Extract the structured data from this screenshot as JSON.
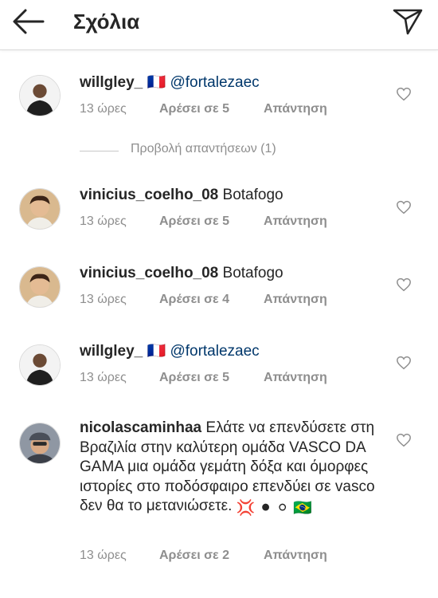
{
  "header": {
    "title": "Σχόλια",
    "back_icon": "arrow-left-icon",
    "send_icon": "paper-plane-icon"
  },
  "labels": {
    "reply": "Απάντηση"
  },
  "comments": [
    {
      "username": "willgley_",
      "flag": "🇫🇷",
      "text": "@fortalezaec",
      "time": "13 ώρες",
      "likes": "Αρέσει σε 5",
      "replies_label": "Προβολή απαντήσεων (1)"
    },
    {
      "username": "vinicius_coelho_08",
      "text": "Botafogo",
      "time": "13 ώρες",
      "likes": "Αρέσει σε 5"
    },
    {
      "username": "vinicius_coelho_08",
      "text": "Botafogo",
      "time": "13 ώρες",
      "likes": "Αρέσει σε 4"
    },
    {
      "username": "willgley_",
      "flag": "🇫🇷",
      "text": "@fortalezaec",
      "time": "13 ώρες",
      "likes": "Αρέσει σε 5"
    },
    {
      "username": "nicolascaminhaa",
      "text": "Ελάτε να επενδύσετε στη Βραζιλία στην καλύτερη ομάδα VASCO DA GAMA μια ομάδα γεμάτη δόξα και όμορφες ιστορίες στο ποδόσφαιρο επενδύει σε vasco δεν θα το μετανιώσετε.",
      "emojis": "💢 ⚫ ⚪ 🇧🇷",
      "time": "13 ώρες",
      "likes": "Αρέσει σε 2"
    }
  ],
  "colors": {
    "text": "#262626",
    "secondary": "#8e8e8e",
    "divider": "#dbdbdb",
    "mention": "#00376b"
  }
}
